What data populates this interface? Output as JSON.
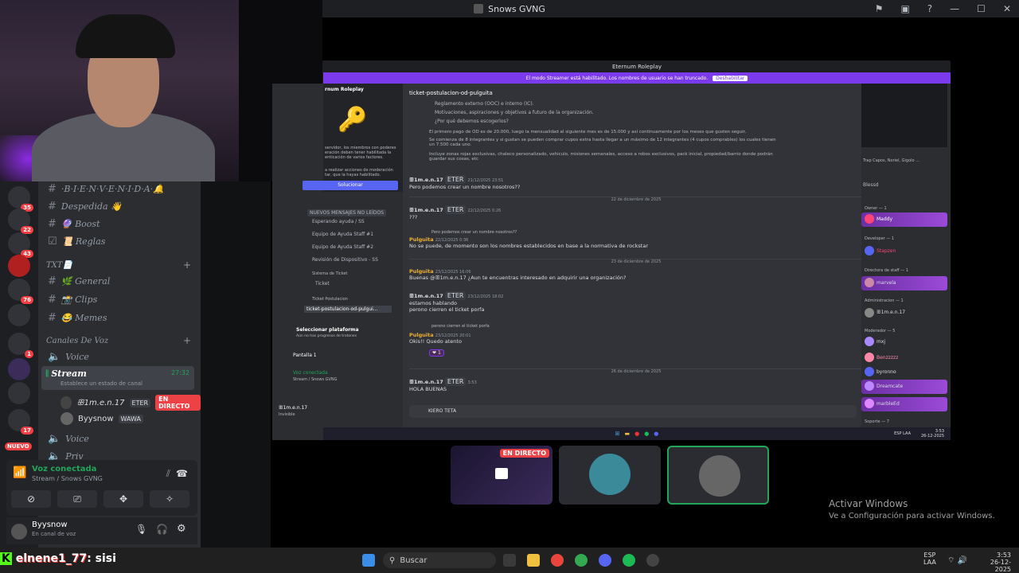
{
  "app": {
    "window_title": "Snows GVNG"
  },
  "inner_window": {
    "title": "Eternum Roleplay",
    "banner_text": "El modo Streamer está habilitado. Los nombres de usuario se han truncado.",
    "banner_button": "Deshabilitar",
    "server_name": "rnum Roleplay",
    "channel_title": "ticket-postulacion-od-pulguita",
    "side_text_1": "servidor, los miembros con poderes eración deben tener habilitada la enticación de varios factores.",
    "side_text_2": "a realizar acciones de moderación tar, que la hayas habilitado.",
    "solve_button": "Solucionar",
    "new_messages": "NUEVOS MENSAJES NO LEÍDOS",
    "inner_channels": [
      "Esperando ayuda / SS",
      "Equipo de Ayuda Staff #1",
      "Equipo de Ayuda Staff #2",
      "Revisión de Dispositivo - SS"
    ],
    "ticket_system": "Sistema de Ticket",
    "ticket_channel": "Ticket",
    "ticket_postulacion": "Ticket Postulacion",
    "active_channel": "ticket-postulacion-od-pulgui...",
    "select_platform": "Seleccionar plataforma",
    "select_platform_sub": "Aún no has progresos de trotones",
    "screen": "Pantalla 1",
    "voice_connected": "Voz conectada",
    "voice_path": "Stream / Snows GVNG",
    "user": "ꕥ1m.e.n.17",
    "user_status": "Invisible",
    "input_text": "KIERO TETA",
    "messages": [
      {
        "name": "ꕥ1m.e.n.17",
        "tag": "ETER",
        "time": "21/12/2025 23:51",
        "text": "Pero podemos crear un nombre nosotros??"
      },
      {
        "name": "ꕥ1m.e.n.17",
        "tag": "ETER",
        "time": "22/12/2025 0:26",
        "text": "???"
      },
      {
        "name": "Pulguita",
        "tag": "",
        "time": "22/12/2025 0:36",
        "text": "No se puede, de momento son los nombres establecidos en base a la normativa de rockstar"
      },
      {
        "name": "Pulguita",
        "tag": "",
        "time": "23/12/2025 16:06",
        "text": "Buenas @ꕥ1m.e.n.17  ¿Aun te encuentras interesado en adquirir una organización?"
      },
      {
        "name": "ꕥ1m.e.n.17",
        "tag": "ETER",
        "time": "23/12/2025 18:02",
        "text": "estamos hablando"
      },
      {
        "name": "",
        "tag": "",
        "time": "",
        "text": "perono cierren el ticket porfa"
      },
      {
        "name": "Pulguita",
        "tag": "",
        "time": "23/12/2025 20:01",
        "text": "Okis!! Quedo atento"
      },
      {
        "name": "ꕥ1m.e.n.17",
        "tag": "ETER",
        "time": "3:53",
        "text": "HOLA BUENAS"
      }
    ],
    "reply_1": "Pero podemos crear un nombre nosotros??",
    "reply_2": "perono cierren el ticket porfa",
    "bullets": [
      "Reglamento externo (OOC) e interno (IC).",
      "Motivaciones, aspiraciones y objetivos a futuro de la organización.",
      "¿Por qué debemos escogerlos?"
    ],
    "para_1": "El primero pago de OD es de 20.000, luego la mensualidad al siguiente mes es de 15.000 y así continuamente por los meses que gusten seguir.",
    "para_2": "Se comienza de 8 integrantes y si gustan se pueden comprar cupos extra hasta llegar a un máximo de 12 integrantes (4 cupos comprables) los cuales tienen un 7.500 cada uno.",
    "para_3": "Incluye zonas rojas exclusivas, chaleco personalizado, vehiculo, misiones semanales, acceso a robos exclusivos, pack inicial, propiedad/barrio donde podrán guardar sus cosas, etc",
    "date_sep_1": "22 de diciembre de 2025",
    "date_sep_2": "23 de diciembre de 2025",
    "date_sep_3": "26 de diciembre de 2025",
    "reaction_count": "1",
    "members": [
      {
        "role": "Trap Capos, Noriel, Gigolo ...",
        "name": ""
      },
      {
        "role": "",
        "name": "Blessd"
      },
      {
        "role": "Owner — 1",
        "name": "Maddy"
      },
      {
        "role": "Developer — 1",
        "name": "Stapzen"
      },
      {
        "role": "Directora de staff — 1",
        "name": "marvela"
      },
      {
        "role": "Administracion — 1",
        "name": "ꕥ1m.e.n.17"
      },
      {
        "role": "Moderador — 5",
        "name": "mxj"
      },
      {
        "role": "",
        "name": "Benzzzzz"
      },
      {
        "role": "",
        "name": "byronno"
      },
      {
        "role": "",
        "name": "Dreamcate"
      },
      {
        "role": "",
        "name": "marbleEd"
      },
      {
        "role": "Soporte — 7",
        "name": ""
      }
    ],
    "taskbar_lang": "ESP LAA",
    "taskbar_time": "3:53",
    "taskbar_date": "26-12-2025"
  },
  "sidebar": {
    "channels": [
      {
        "icon": "#",
        "label": "·B·I·E·N·V·E·N·I·D·A·🔔"
      },
      {
        "icon": "#",
        "label": "Despedida 👋"
      },
      {
        "icon": "#",
        "label": "🔮 Boost"
      },
      {
        "icon": "☑",
        "label": "📜 Reglas"
      }
    ],
    "txt_category": "TXT📄",
    "txt_channels": [
      "🌿 General",
      "📸 Clips",
      "😂 Memes"
    ],
    "voice_category": "Canales De Voz",
    "voice_channels": [
      "Voice",
      "Stream"
    ],
    "stream_time": "27:32",
    "stream_status": "Establece un estado de canal",
    "voice_users": [
      {
        "name": "ꕥ1m.e.n.17",
        "tag": "ETER",
        "live": "EN DIRECTO"
      },
      {
        "name": "Byysnow",
        "tag": "WAWA",
        "live": ""
      }
    ],
    "after_voice": [
      "Voice",
      "Priv"
    ],
    "server_badges": [
      "35",
      "22",
      "43",
      "76",
      "1",
      "17"
    ],
    "nuevo_label": "NUEVO"
  },
  "voice_panel": {
    "status": "Voz conectada",
    "path": "Stream / Snows GVNG"
  },
  "user_panel": {
    "name": "Byysnow",
    "status": "En canal de voz"
  },
  "stream_thumbs": {
    "live_label": "EN DIRECTO"
  },
  "activate": {
    "title": "Activar Windows",
    "sub": "Ve a Configuración para activar Windows."
  },
  "taskbar": {
    "search_placeholder": "Buscar",
    "lang": "ESP",
    "lang2": "LAA",
    "time": "3:53",
    "date": "26-12-2025"
  },
  "overlay": {
    "chat_user": "elnene1_77",
    "chat_text": ": sisi"
  }
}
